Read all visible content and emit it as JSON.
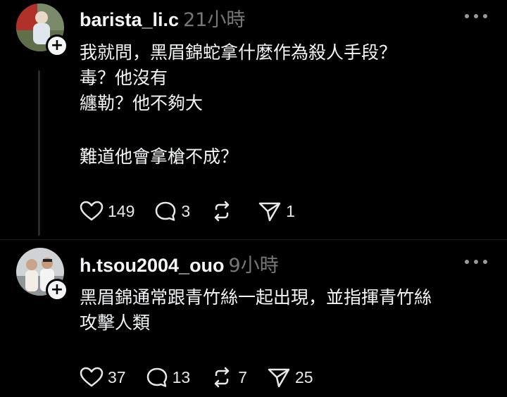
{
  "posts": [
    {
      "username": "barista_li.c",
      "time": "21小時",
      "lines": [
        "我就問，黑眉錦蛇拿什麼作為殺人手段？",
        "毒？他沒有",
        "纏勒？他不夠大",
        "",
        "難道他會拿槍不成？"
      ],
      "likes": "149",
      "replies": "3",
      "reposts": "",
      "shares": "1"
    },
    {
      "username": "h.tsou2004_ouo",
      "time": "9小時",
      "lines": [
        "黑眉錦通常跟青竹絲一起出現，並指揮青竹絲",
        "攻擊人類"
      ],
      "likes": "37",
      "replies": "13",
      "reposts": "7",
      "shares": "25"
    }
  ]
}
